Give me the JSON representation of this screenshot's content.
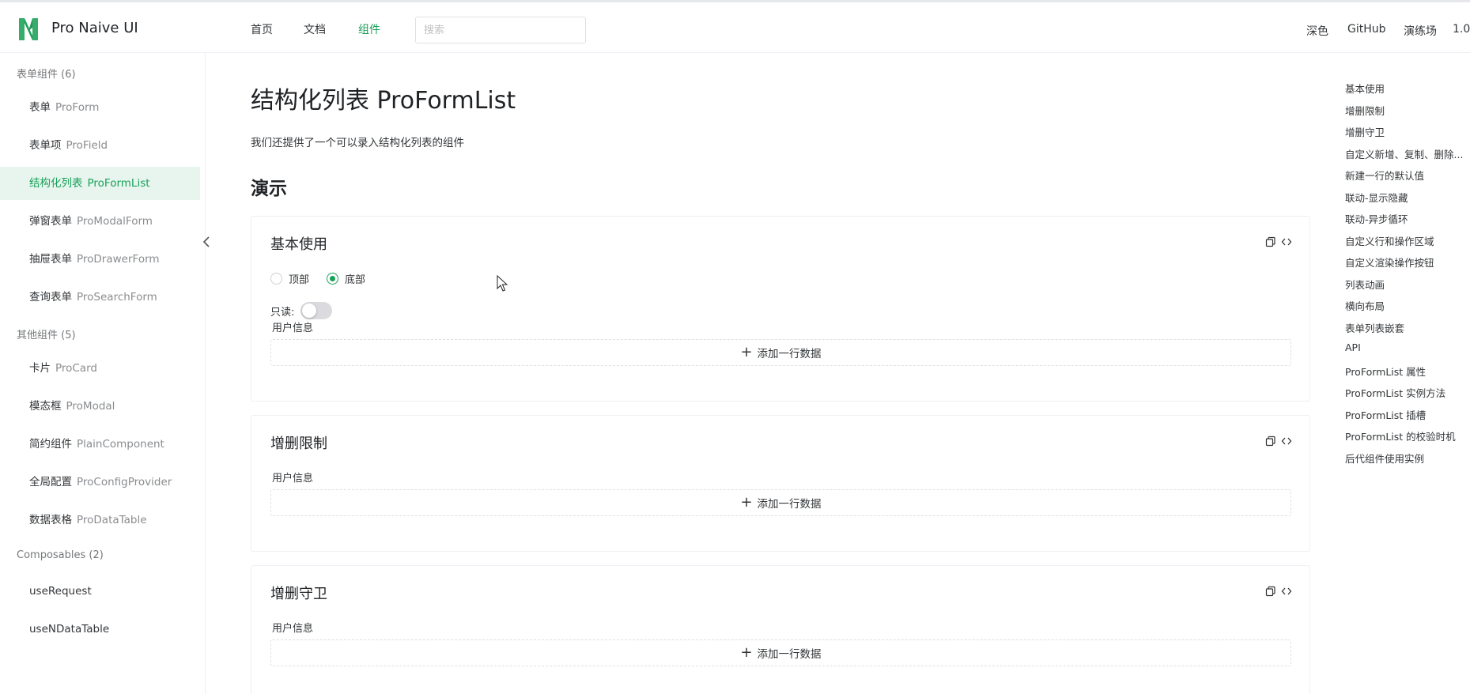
{
  "header": {
    "brand": "Pro Naive UI",
    "nav": [
      {
        "label": "首页"
      },
      {
        "label": "文档"
      },
      {
        "label": "组件",
        "active": true
      }
    ],
    "search_placeholder": "搜索",
    "right": {
      "theme": "深色",
      "github": "GitHub",
      "playground": "演练场",
      "version": "1.0."
    },
    "accent": "#18a058"
  },
  "sidebar": {
    "groups": [
      {
        "title": "表单组件 (6)",
        "items": [
          {
            "label": "表单",
            "sub": "ProForm"
          },
          {
            "label": "表单项",
            "sub": "ProField"
          },
          {
            "label": "结构化列表",
            "sub": "ProFormList",
            "active": true
          },
          {
            "label": "弹窗表单",
            "sub": "ProModalForm"
          },
          {
            "label": "抽屉表单",
            "sub": "ProDrawerForm"
          },
          {
            "label": "查询表单",
            "sub": "ProSearchForm"
          }
        ]
      },
      {
        "title": "其他组件 (5)",
        "items": [
          {
            "label": "卡片",
            "sub": "ProCard"
          },
          {
            "label": "模态框",
            "sub": "ProModal"
          },
          {
            "label": "简约组件",
            "sub": "PlainComponent"
          },
          {
            "label": "全局配置",
            "sub": "ProConfigProvider"
          },
          {
            "label": "数据表格",
            "sub": "ProDataTable"
          }
        ]
      },
      {
        "title": "Composables (2)",
        "items": [
          {
            "label": "useRequest",
            "sub": ""
          },
          {
            "label": "useNDataTable",
            "sub": ""
          }
        ]
      }
    ]
  },
  "main": {
    "title": "结构化列表 ProFormList",
    "description": "我们还提供了一个可以录入结构化列表的组件",
    "section": "演示",
    "cards": [
      {
        "title": "基本使用",
        "radios": [
          {
            "label": "顶部",
            "checked": false
          },
          {
            "label": "底部",
            "checked": true
          }
        ],
        "readonly_label": "只读:",
        "field_label": "用户信息",
        "add_label": "添加一行数据"
      },
      {
        "title": "增删限制",
        "field_label": "用户信息",
        "add_label": "添加一行数据"
      },
      {
        "title": "增删守卫",
        "field_label": "用户信息",
        "add_label": "添加一行数据"
      }
    ]
  },
  "anchors": [
    "基本使用",
    "增删限制",
    "增删守卫",
    "自定义新增、复制、删除...",
    "新建一行的默认值",
    "联动-显示隐藏",
    "联动-异步循环",
    "自定义行和操作区域",
    "自定义渲染操作按钮",
    "列表动画",
    "横向布局",
    "表单列表嵌套",
    "API",
    "ProFormList 属性",
    "ProFormList 实例方法",
    "ProFormList 插槽",
    "ProFormList 的校验时机",
    "后代组件使用实例"
  ]
}
